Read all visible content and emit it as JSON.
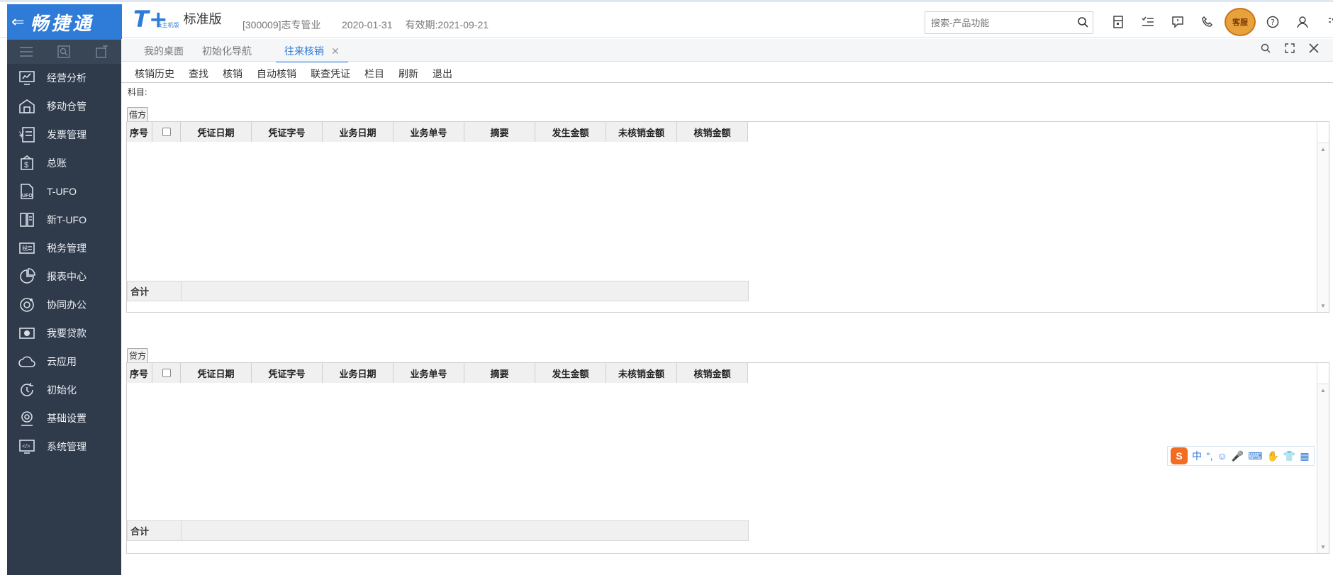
{
  "brand": {
    "back": "⇐",
    "name": "畅捷通"
  },
  "logo": {
    "mark": "T+",
    "sub": "云主机版",
    "edition": "标准版"
  },
  "account": "[300009]志专管业",
  "login_date": "2020-01-31",
  "validity": "有效期:2021-09-21",
  "search": {
    "placeholder": "搜索-产品功能"
  },
  "top_icons": [
    "calculator-icon",
    "task-list-icon",
    "message-icon",
    "phone-icon",
    "customer-service-icon",
    "help-icon",
    "user-icon",
    "more-icon"
  ],
  "service_badge": "客服",
  "sidebar": {
    "items": [
      {
        "label": "经营分析",
        "icon": "analysis-icon"
      },
      {
        "label": "移动仓管",
        "icon": "warehouse-icon"
      },
      {
        "label": "发票管理",
        "icon": "invoice-icon"
      },
      {
        "label": "总账",
        "icon": "ledger-icon"
      },
      {
        "label": "T-UFO",
        "icon": "ufo-icon"
      },
      {
        "label": "新T-UFO",
        "icon": "new-ufo-icon"
      },
      {
        "label": "税务管理",
        "icon": "tax-icon"
      },
      {
        "label": "报表中心",
        "icon": "report-icon"
      },
      {
        "label": "协同办公",
        "icon": "collaboration-icon"
      },
      {
        "label": "我要贷款",
        "icon": "loan-icon"
      },
      {
        "label": "云应用",
        "icon": "cloud-icon"
      },
      {
        "label": "初始化",
        "icon": "init-icon"
      },
      {
        "label": "基础设置",
        "icon": "settings-icon"
      },
      {
        "label": "系统管理",
        "icon": "system-icon"
      }
    ]
  },
  "tabs": [
    {
      "label": "我的桌面"
    },
    {
      "label": "初始化导航"
    },
    {
      "label": "往来核销",
      "active": true,
      "close": "✕"
    }
  ],
  "toolbar": [
    "核销历史",
    "查找",
    "核销",
    "自动核销",
    "联查凭证",
    "栏目",
    "刷新",
    "退出"
  ],
  "subject_label": "科目:",
  "debit": {
    "tag": "借方",
    "columns": [
      "序号",
      "凭证日期",
      "凭证字号",
      "业务日期",
      "业务单号",
      "摘要",
      "发生金额",
      "未核销金额",
      "核销金额"
    ],
    "total_label": "合计"
  },
  "credit": {
    "tag": "贷方",
    "columns": [
      "序号",
      "凭证日期",
      "凭证字号",
      "业务日期",
      "业务单号",
      "摘要",
      "发生金额",
      "未核销金额",
      "核销金额"
    ],
    "total_label": "合计"
  },
  "ime": {
    "logo": "S",
    "mode": "中",
    "punct": "°,",
    "emoji": "☺",
    "mic": "🎤",
    "keyboard": "⌨"
  },
  "colors": {
    "brand": "#2e7bd8",
    "sidebar": "#2f3a4a",
    "ime_logo": "#f36c21"
  }
}
